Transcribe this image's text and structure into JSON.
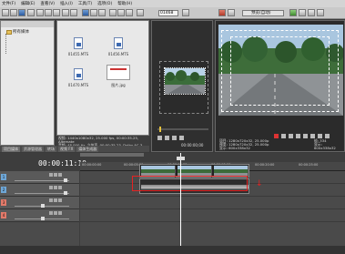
{
  "menubar": {
    "items": [
      "文件(F)",
      "编辑(E)",
      "查看(V)",
      "插入(I)",
      "工具(T)",
      "选项(O)",
      "帮助(H)"
    ]
  },
  "toolbar": {
    "zoom": "01468",
    "preview_mode": "预览(自动)"
  },
  "explorer": {
    "folder_label": "所有媒体"
  },
  "media": {
    "items": [
      {
        "label": "01455.MTS",
        "kind": "video"
      },
      {
        "label": "01456.MTS",
        "kind": "video"
      },
      {
        "label": "01470.MTS",
        "kind": "video"
      },
      {
        "label": "图片.jpg",
        "kind": "image"
      }
    ]
  },
  "info": {
    "lines": [
      "视频: 1440x1080x32, 25.000 fps, 00:00:35.25, Alternate",
      "音频: 48,000 Hz, 立体声, 00:00:35.23, Dolby AC-3",
      "指示: 共享媒体  媒体生成器"
    ]
  },
  "left_tabs": [
    "项目媒体",
    "资源管理器",
    "转场",
    "视频 FX",
    "媒体生成器"
  ],
  "trimmer": {
    "time": "00:00:00;00"
  },
  "preview": {
    "info_lines": [
      "项目: 1280x720x32, 25.000p",
      "预览: 1280x720x32, 25.000p",
      "显示: 600x338x32"
    ],
    "frame_lines": [
      "帧: 334",
      "显示: 600x338x32"
    ]
  },
  "timeline": {
    "timecode": "00:00:11:10",
    "ruler_labels": [
      "00:00:00:00",
      "00:00:05:00",
      "00:00:10:00",
      "00:00:15:00",
      "00:00:20:00",
      "00:00:25:00"
    ],
    "tracks": [
      {
        "number": "1",
        "type": "video"
      },
      {
        "number": "2",
        "type": "video"
      },
      {
        "number": "3",
        "type": "audio"
      },
      {
        "number": "4",
        "type": "audio"
      }
    ]
  },
  "colors": {
    "highlight": "#e52222",
    "video_track": "#6ea7d8",
    "audio_track": "#e27a6a"
  }
}
